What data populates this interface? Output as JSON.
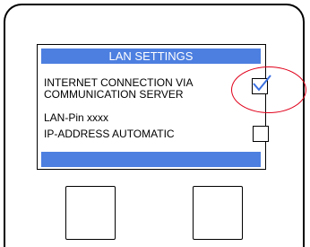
{
  "screen": {
    "title": "LAN SETTINGS",
    "rows": [
      {
        "line1": "INTERNET CONNECTION VIA",
        "line2": "COMMUNICATION SERVER",
        "checked": true
      },
      {
        "line1": "LAN-Pin  xxxx",
        "line2": "IP-ADDRESS AUTOMATIC",
        "checked": false
      }
    ]
  },
  "colors": {
    "bar": "#4d7fe0",
    "checkmark": "#3a6fe0",
    "highlight": "#e0001a"
  },
  "icons": {
    "checkmark": "checkmark-icon"
  }
}
